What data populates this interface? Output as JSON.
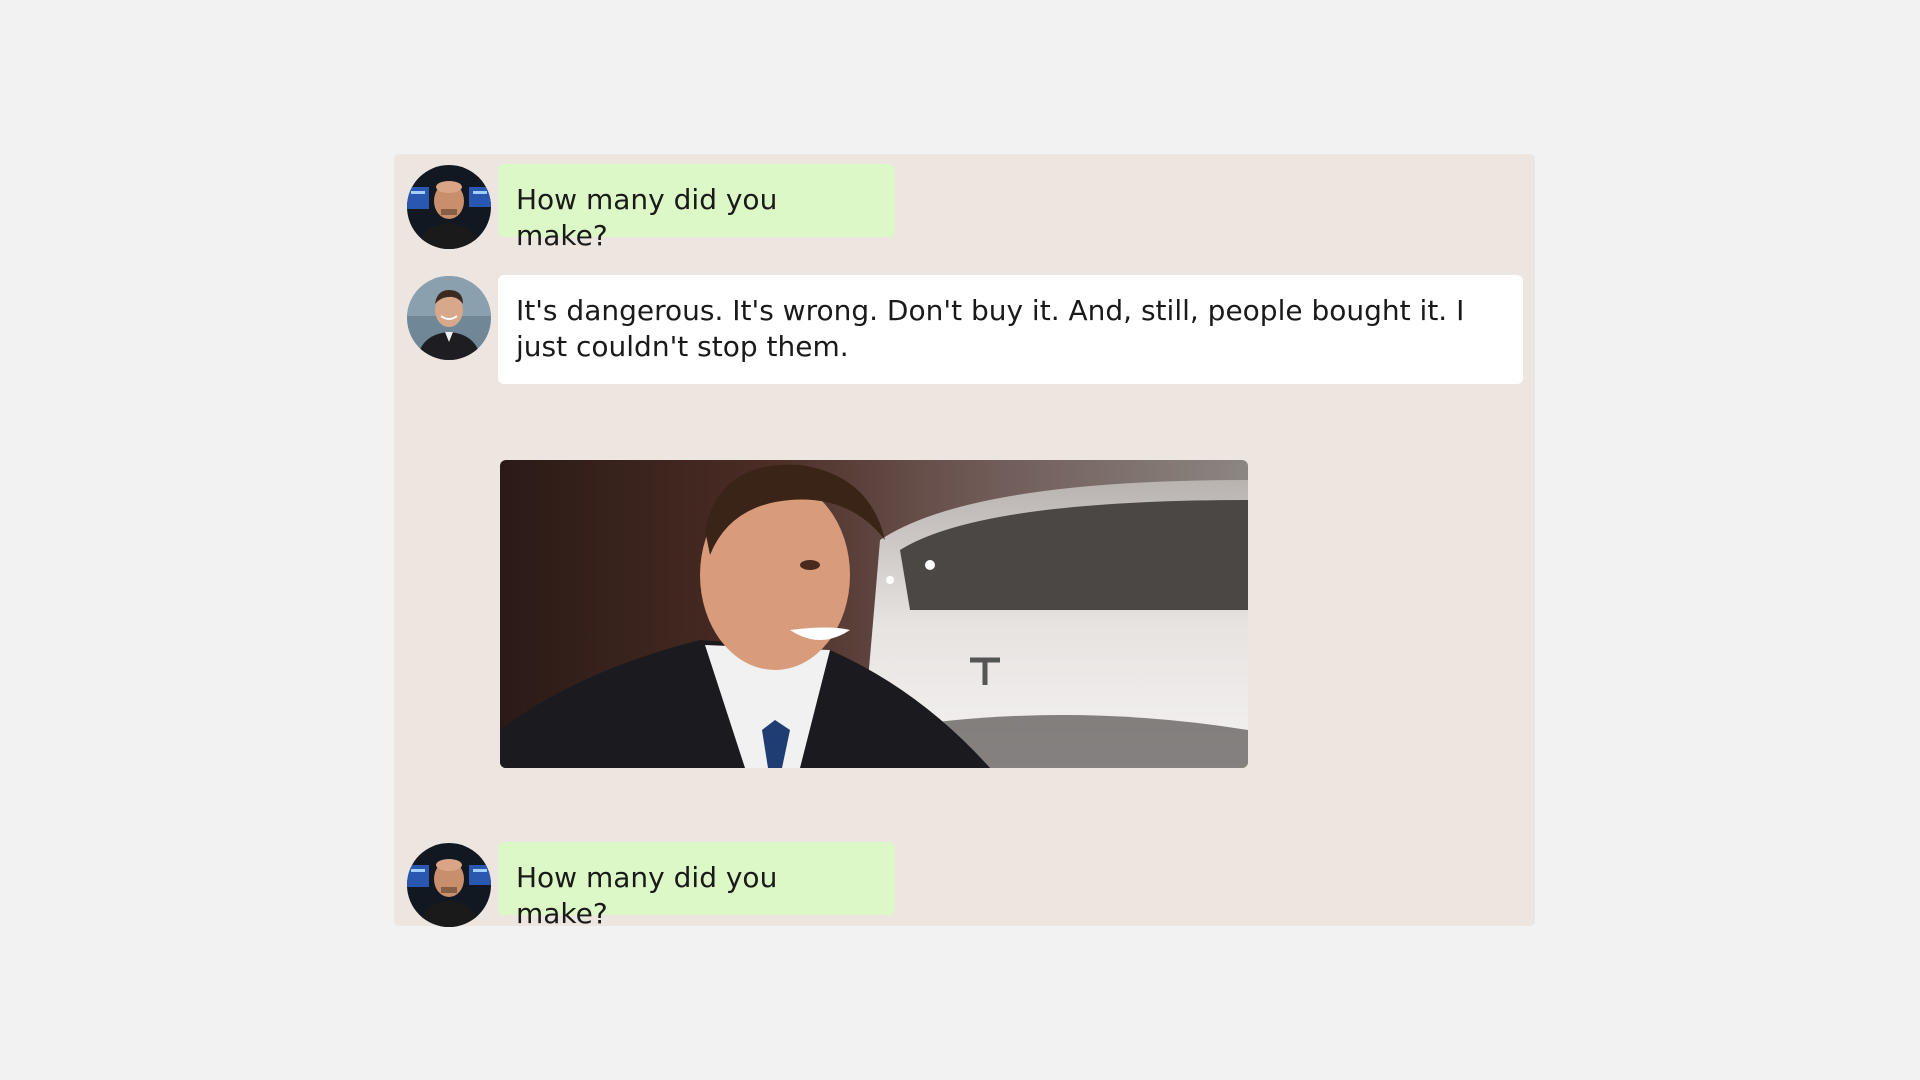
{
  "conversation": {
    "messages": [
      {
        "sender": "person-a",
        "type": "text",
        "bubble_color": "#dcf8c6",
        "text": "How many did you make?"
      },
      {
        "sender": "person-b",
        "type": "text",
        "bubble_color": "#ffffff",
        "text": "It's dangerous. It's wrong. Don't buy it. And, still, people bought it. I just couldn't stop them."
      },
      {
        "sender": "person-b",
        "type": "image",
        "icon": "laughing-man-photo"
      },
      {
        "sender": "person-a",
        "type": "text",
        "bubble_color": "#dcf8c6",
        "text": "How many did you make?"
      }
    ]
  },
  "colors": {
    "page_background": "#f2f2f2",
    "panel_background": "#ede5e0",
    "outgoing_bubble": "#dcf8c6",
    "incoming_bubble": "#ffffff"
  }
}
